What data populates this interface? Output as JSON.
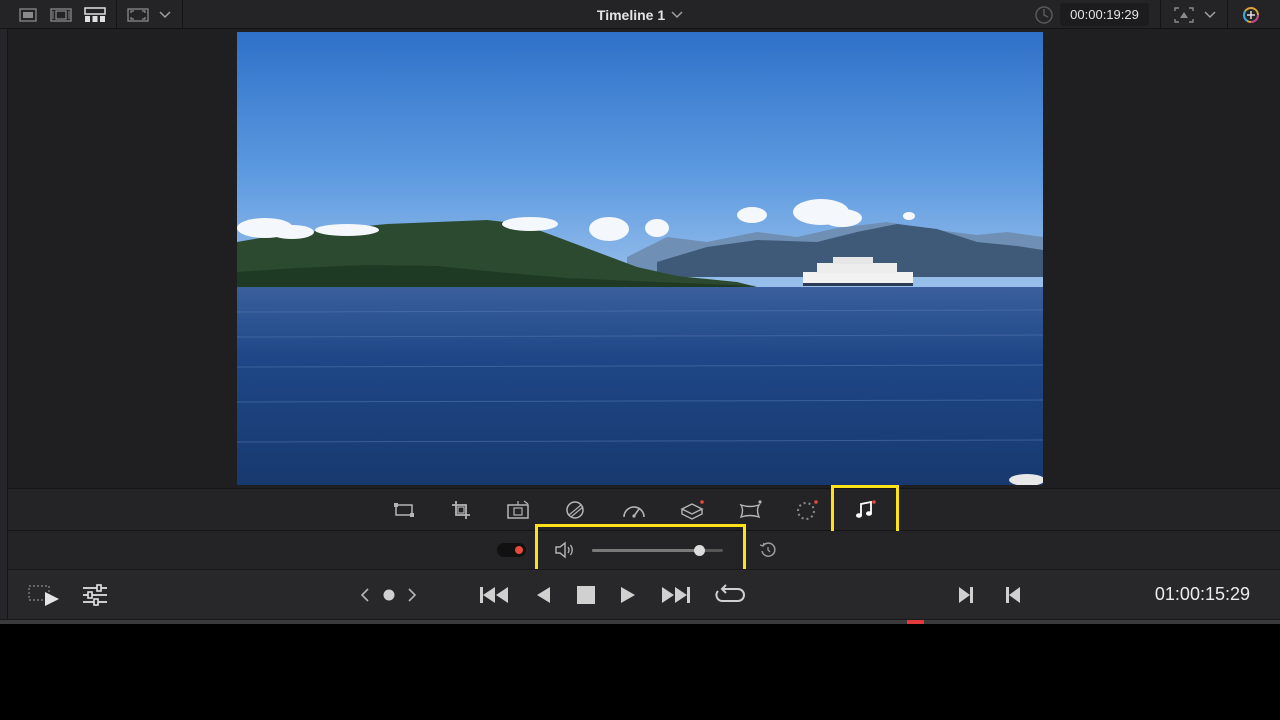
{
  "topbar": {
    "title": "Timeline 1",
    "timecode": "00:00:19:29",
    "icons": [
      "media-pool-view-icon",
      "clip-view-icon",
      "grid-view-icon",
      "viewer-size-icon",
      "chevron-down-icon",
      "timecode-clock-icon",
      "viewer-mode-icon",
      "chevron-down-icon",
      "color-wheel-icon"
    ]
  },
  "viewer": {
    "image_description_icon": "video-frame-image"
  },
  "inspector_tools": [
    {
      "name": "transform-tool",
      "icon": "transform-icon"
    },
    {
      "name": "crop-tool",
      "icon": "crop-icon"
    },
    {
      "name": "dynamic-zoom-tool",
      "icon": "dynamic-zoom-icon"
    },
    {
      "name": "composite-tool",
      "icon": "composite-icon"
    },
    {
      "name": "speed-tool",
      "icon": "speed-icon"
    },
    {
      "name": "stabilization-tool",
      "icon": "stabilization-icon"
    },
    {
      "name": "lens-correction-tool",
      "icon": "lens-correction-icon"
    },
    {
      "name": "effects-tool",
      "icon": "effects-icon"
    },
    {
      "name": "audio-tool",
      "icon": "music-note-icon",
      "active": true
    }
  ],
  "audio": {
    "volume_level": 0.82,
    "toggle_on": true
  },
  "transport": {
    "timecode": "01:00:15:29"
  },
  "colors": {
    "highlight": "#ffe11a",
    "toggle_dot": "#e8493a",
    "playhead": "#e03a3a"
  }
}
